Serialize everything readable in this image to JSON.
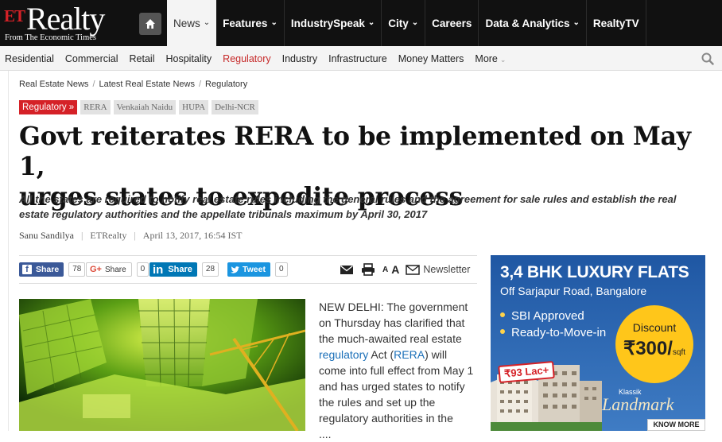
{
  "brand": {
    "logo_prefix": "ET",
    "logo_name": "Realty",
    "tagline": "From The Economic Times"
  },
  "topnav": {
    "home_icon": "home-icon",
    "items": [
      {
        "label": "News",
        "dropdown": true,
        "active": true
      },
      {
        "label": "Features",
        "dropdown": true
      },
      {
        "label": "IndustrySpeak",
        "dropdown": true
      },
      {
        "label": "City",
        "dropdown": true
      },
      {
        "label": "Careers",
        "dropdown": false
      },
      {
        "label": "Data & Analytics",
        "dropdown": true
      },
      {
        "label": "RealtyTV",
        "dropdown": false
      }
    ],
    "dropdown_glyph": "⌄"
  },
  "subnav": {
    "items": [
      {
        "label": "Residential"
      },
      {
        "label": "Commercial"
      },
      {
        "label": "Retail"
      },
      {
        "label": "Hospitality"
      },
      {
        "label": "Regulatory",
        "active": true
      },
      {
        "label": "Industry"
      },
      {
        "label": "Infrastructure"
      },
      {
        "label": "Money Matters"
      },
      {
        "label": "More",
        "dropdown": true
      }
    ],
    "search_icon": "search-icon"
  },
  "breadcrumb": [
    "Real Estate News",
    "Latest Real Estate News",
    "Regulatory"
  ],
  "breadcrumb_sep": "/",
  "tags": {
    "primary": "Regulatory »",
    "items": [
      "RERA",
      "Venkaiah Naidu",
      "HUPA",
      "Delhi-NCR"
    ]
  },
  "article": {
    "headline_line1": "Govt reiterates RERA to be implemented on May 1,",
    "headline_line2": "urges states to expedite process",
    "synopsis": "All the states are required to notify real estate rules including the general rules and the agreement for sale rules and establish the real estate regulatory authorities and the appellate tribunals maximum by April 30, 2017",
    "author": "Sanu Sandilya",
    "source": "ETRealty",
    "date": "April 13, 2017, 16:54 IST",
    "byline_sep": "|",
    "body_parts": [
      "NEW DELHI: The government on Thursday has clarified that the much-awaited real estate ",
      "regulatory",
      " Act (",
      "RERA",
      ") will come into full effect from May 1 and has urged states to notify the rules and set up the regulatory authorities in the",
      "...."
    ]
  },
  "share": {
    "facebook": {
      "label": "Share",
      "count": "78"
    },
    "google": {
      "prefix": "G+",
      "label": "Share",
      "count": "0"
    },
    "linkedin": {
      "prefix": "in",
      "label": "Share",
      "count": "28"
    },
    "twitter": {
      "label": "Tweet",
      "count": "0"
    }
  },
  "tools": {
    "email_icon": "email-icon",
    "print_icon": "print-icon",
    "font_small": "A",
    "font_large": "A",
    "newsletter_label": "Newsletter"
  },
  "ad": {
    "title": "3,4 BHK LUXURY FLATS",
    "subtitle": "Off Sarjapur Road, Bangalore",
    "features": [
      "SBI Approved",
      "Ready-to-Move-in"
    ],
    "discount_label": "Discount",
    "discount_value": "₹300/",
    "discount_unit": "sqft",
    "price_badge": "₹93 Lac+",
    "brand_small": "Klassik",
    "brand_large": "Landmark",
    "cta": "KNOW MORE"
  },
  "colors": {
    "brand_red": "#d52127",
    "link_blue": "#1a6fb8",
    "ad_blue": "#1f57a3",
    "discount_yellow": "#ffc61a"
  }
}
